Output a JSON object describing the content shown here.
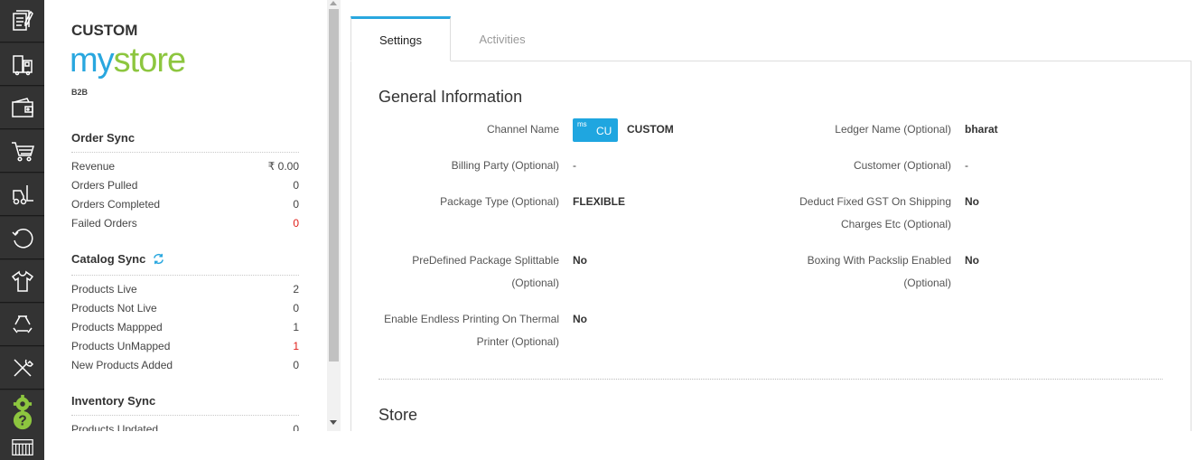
{
  "rail": {
    "icons": [
      "document-icon",
      "truck-icon",
      "wallet-icon",
      "cart-icon",
      "forklift-icon",
      "refresh-icon",
      "shirt-icon",
      "recycle-icon",
      "tools-icon"
    ],
    "help_icons": [
      "gear-icon",
      "help-icon"
    ],
    "bottom_icon": "barcode-icon",
    "icon_color": "#ffffff",
    "accent_color": "#8dc63f"
  },
  "brand": {
    "name": "CUSTOM",
    "logo_part1": "my",
    "logo_part2": "store",
    "type": "B2B",
    "logo_colors": {
      "my": "#29a7df",
      "store": "#8dc63f"
    }
  },
  "order_sync": {
    "title": "Order Sync",
    "rows": [
      {
        "label": "Revenue",
        "value": "₹ 0.00"
      },
      {
        "label": "Orders Pulled",
        "value": "0"
      },
      {
        "label": "Orders Completed",
        "value": "0"
      },
      {
        "label": "Failed Orders",
        "value": "0",
        "highlight": true
      }
    ]
  },
  "catalog_sync": {
    "title": "Catalog Sync",
    "icon": "sync-icon",
    "rows": [
      {
        "label": "Products Live",
        "value": "2"
      },
      {
        "label": "Products Not Live",
        "value": "0"
      },
      {
        "label": "Products Mappped",
        "value": "1"
      },
      {
        "label": "Products UnMapped",
        "value": "1",
        "highlight": true
      },
      {
        "label": "New Products Added",
        "value": "0"
      }
    ]
  },
  "inventory_sync": {
    "title": "Inventory Sync",
    "rows": [
      {
        "label": "Products Updated",
        "value": "0"
      }
    ]
  },
  "tabs": [
    {
      "label": "Settings",
      "active": true
    },
    {
      "label": "Activities",
      "active": false
    }
  ],
  "general": {
    "heading": "General Information",
    "badge_ms": "ms",
    "badge_cu": "CU",
    "badge_color": "#1fa6e0",
    "fields": {
      "channel_name": {
        "label": "Channel Name",
        "value": "CUSTOM"
      },
      "ledger_name": {
        "label": "Ledger Name (Optional)",
        "value": "bharat"
      },
      "billing_party": {
        "label": "Billing Party (Optional)",
        "value": "-"
      },
      "customer": {
        "label": "Customer (Optional)",
        "value": "-"
      },
      "package_type": {
        "label": "Package Type (Optional)",
        "value": "FLEXIBLE"
      },
      "deduct_gst_line1": "Deduct Fixed GST On Shipping",
      "deduct_gst_line2": "Charges Etc (Optional)",
      "deduct_gst_value": "No",
      "predefined_line1": "PreDefined Package Splittable",
      "predefined_line2": "(Optional)",
      "predefined_value": "No",
      "boxing_line1": "Boxing With Packslip Enabled",
      "boxing_line2": "(Optional)",
      "boxing_value": "No",
      "endless_line1": "Enable Endless Printing On Thermal",
      "endless_line2": "Printer (Optional)",
      "endless_value": "No"
    }
  },
  "store": {
    "heading": "Store"
  }
}
